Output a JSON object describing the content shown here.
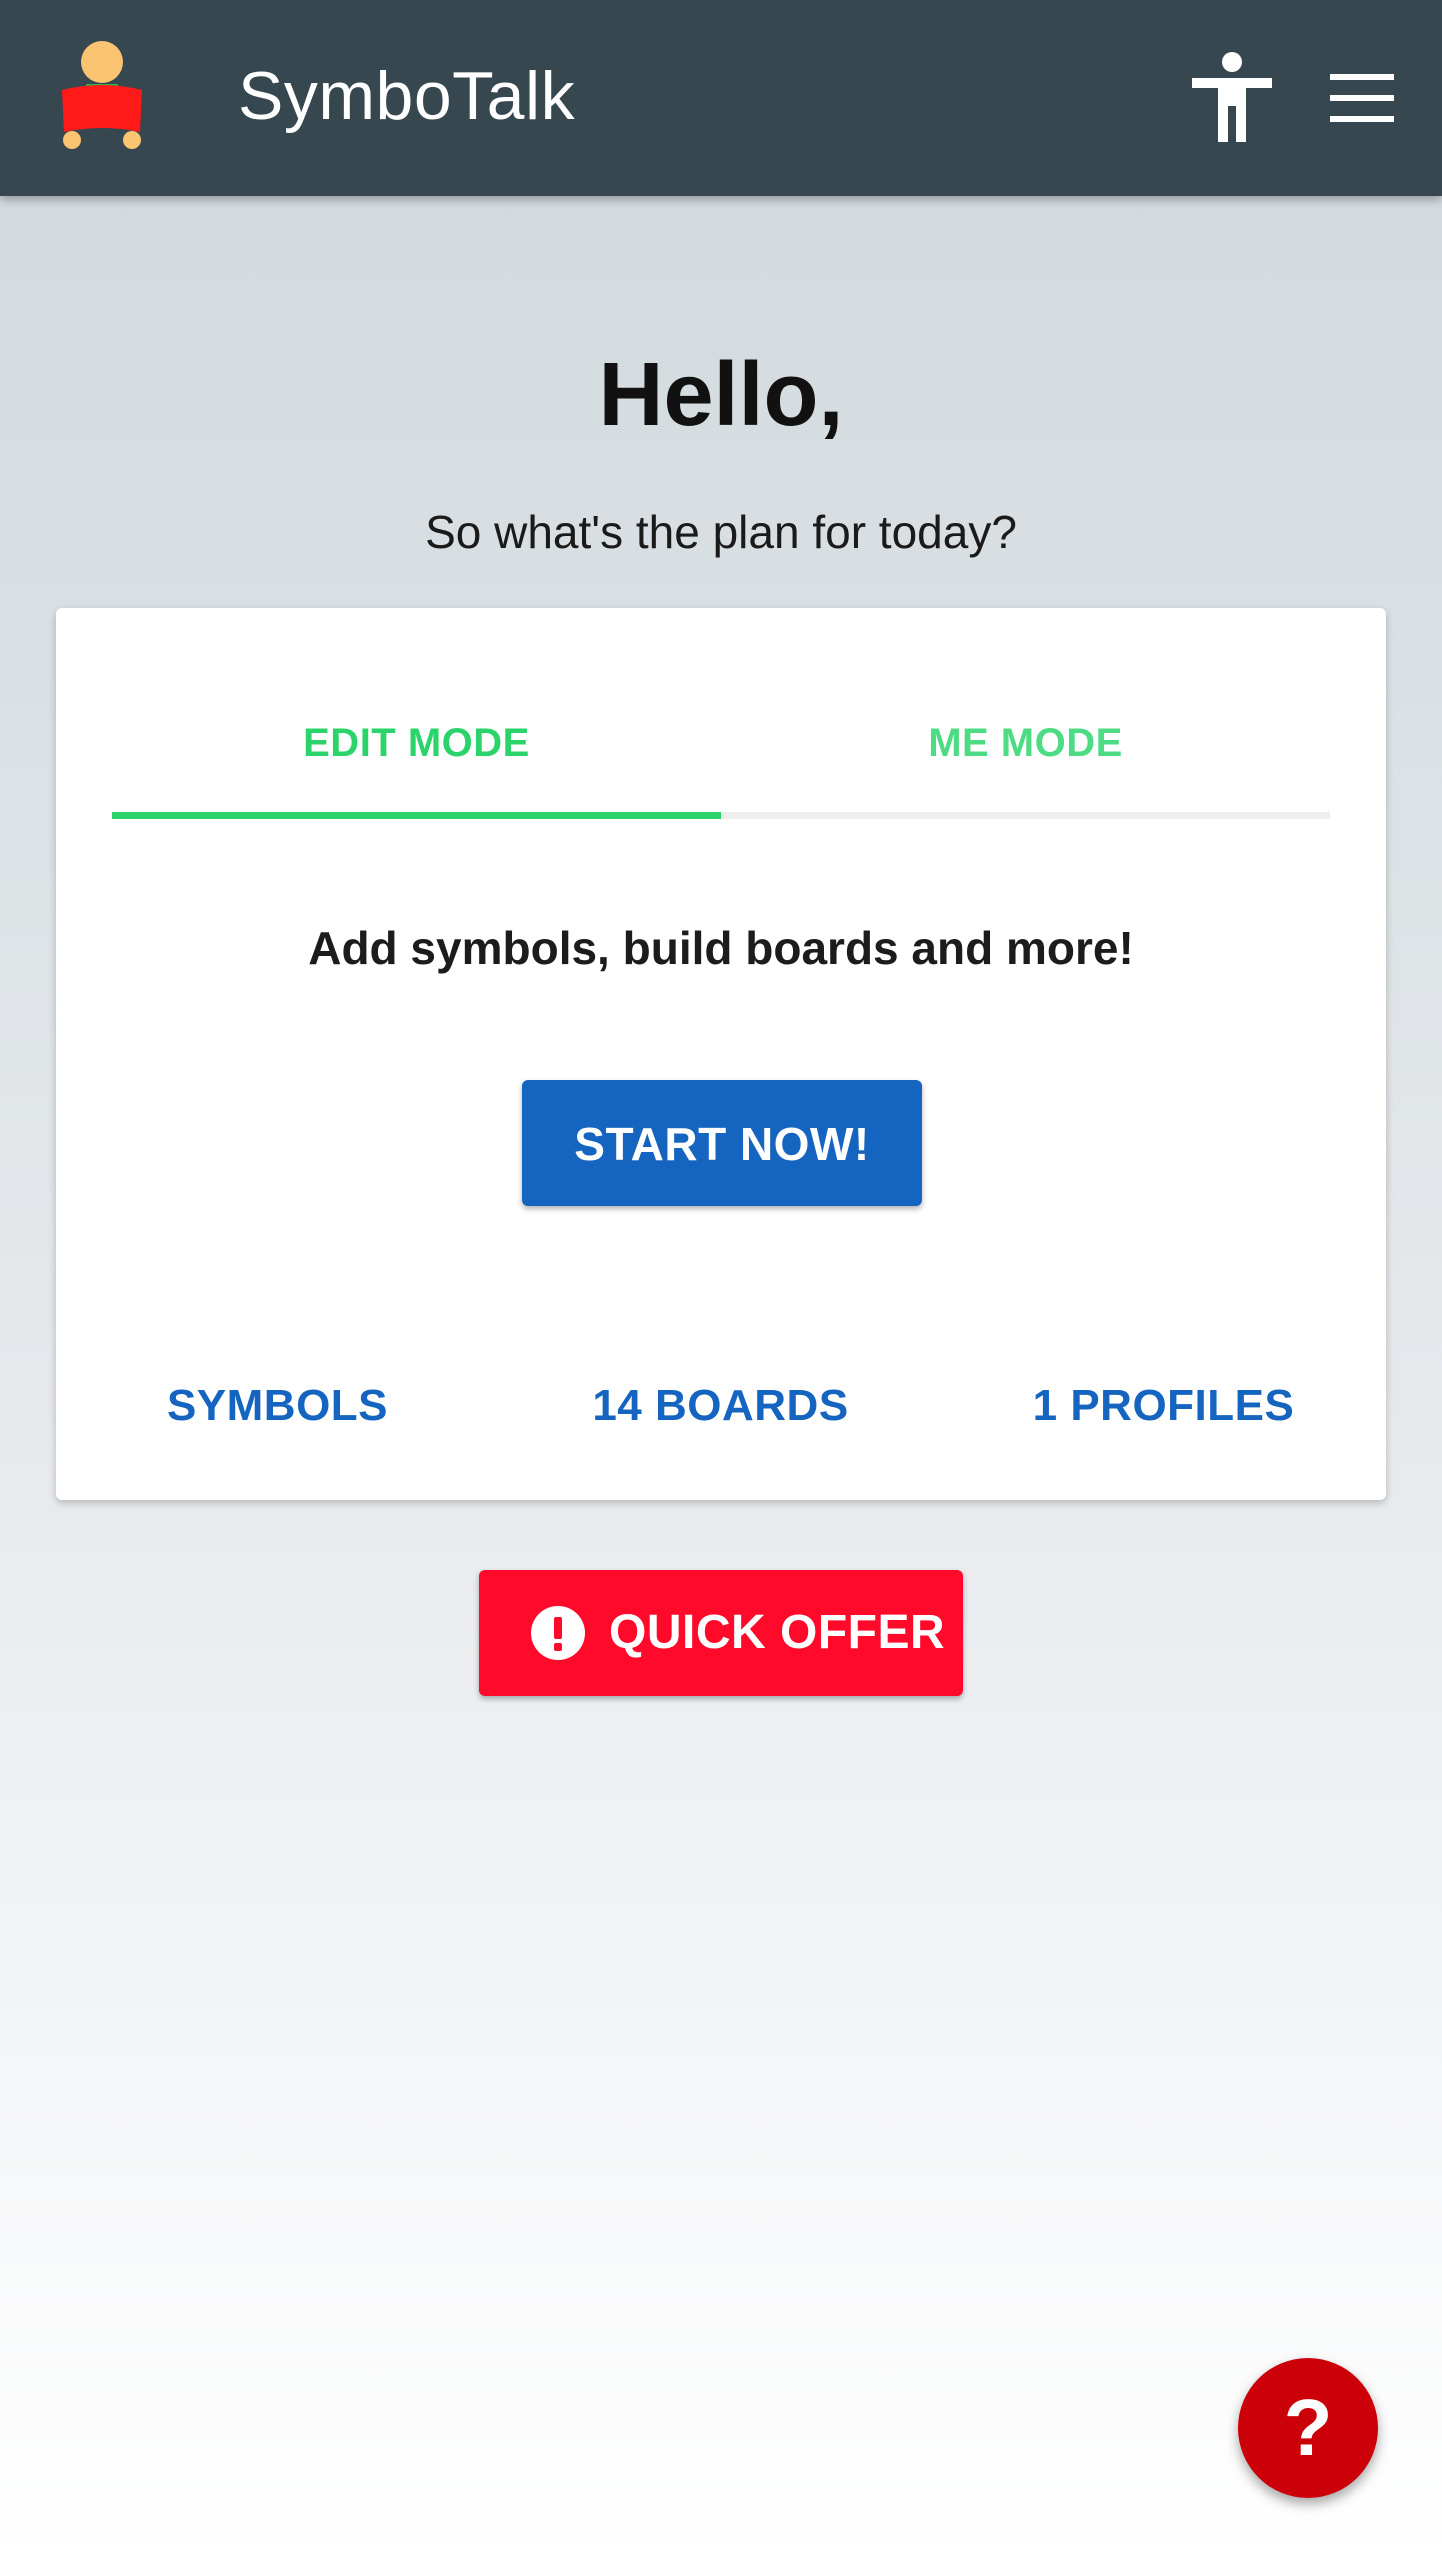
{
  "header": {
    "title": "SymboTalk",
    "logo_icon": "child-reading-icon",
    "accessibility_icon": "accessibility-icon",
    "menu_icon": "hamburger-menu-icon",
    "background_color": "#37474f"
  },
  "main": {
    "greeting": "Hello,",
    "subtitle": "So what's the plan for today?"
  },
  "card": {
    "tabs": [
      {
        "label": "EDIT MODE",
        "active": true
      },
      {
        "label": "ME MODE",
        "active": false
      }
    ],
    "headline": "Add symbols, build boards and more!",
    "start_button_label": "START NOW!",
    "stats": {
      "symbols_label": "SYMBOLS",
      "boards_label": "14 BOARDS",
      "profiles_label": "1 PROFILES"
    }
  },
  "quick_offer": {
    "label": "QUICK OFFER",
    "icon": "alert-circle-icon",
    "color": "#ff0a2b"
  },
  "help_fab": {
    "label": "?",
    "icon": "help-icon",
    "color": "#cc0008"
  },
  "colors": {
    "accent_green": "#2bd46a",
    "primary_blue": "#1565c0"
  }
}
